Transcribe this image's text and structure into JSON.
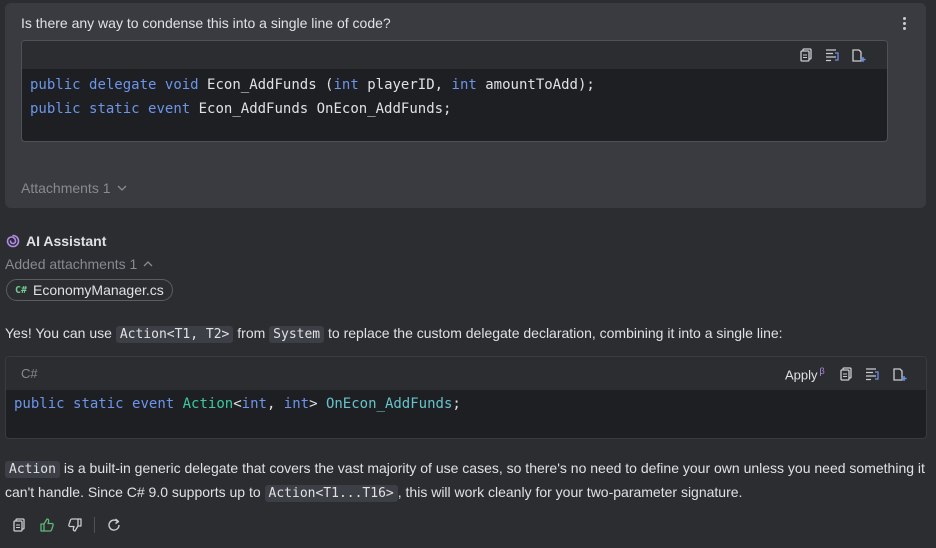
{
  "user_message": {
    "question": "Is there any way to condense this into a single line of code?",
    "code_lines": [
      "public delegate void Econ_AddFunds (int playerID, int amountToAdd);",
      "public static event Econ_AddFunds OnEcon_AddFunds;"
    ],
    "attachments_label": "Attachments 1"
  },
  "assistant": {
    "name": "AI Assistant",
    "added_attachments_label": "Added attachments 1",
    "file_chip": {
      "lang_badge": "C#",
      "file_name": "EconomyManager.cs"
    },
    "para1": {
      "t1": "Yes! You can use ",
      "c1": "Action<T1, T2>",
      "t2": " from ",
      "c2": "System",
      "t3": " to replace the custom delegate declaration, combining it into a single line:"
    },
    "code_block": {
      "language": "C#",
      "apply_label": "Apply",
      "apply_beta": "β",
      "tokens": {
        "public": "public",
        "static": "static",
        "event": "event",
        "action": "Action",
        "lt": "<",
        "int1": "int",
        "comma": ", ",
        "int2": "int",
        "gt": "> ",
        "name": "OnEcon_AddFunds",
        "semi": ";"
      }
    },
    "para2": {
      "c1": "Action",
      "t1": " is a built-in generic delegate that covers the vast majority of use cases, so there's no need to define your own unless you need something it can't handle. Since C# 9.0 supports up to ",
      "c2": "Action<T1...T16>",
      "t2": ", this will work cleanly for your two-parameter signature."
    }
  },
  "icons": {
    "copy": "copy-icon",
    "format": "format-icon",
    "insert": "insert-icon",
    "more": "more-vertical-icon",
    "chevron": "chevron-icon",
    "ai": "ai-assistant-icon",
    "thumbs_up": "thumbs-up-icon",
    "thumbs_down": "thumbs-down-icon",
    "regenerate": "regenerate-icon"
  },
  "colors": {
    "background": "#2b2d30",
    "card": "#393b40",
    "code_bg": "#1e1f22",
    "keyword": "#6c95eb",
    "type": "#39cc9b",
    "accent": "#b08be8",
    "like_active": "#5fb878"
  }
}
